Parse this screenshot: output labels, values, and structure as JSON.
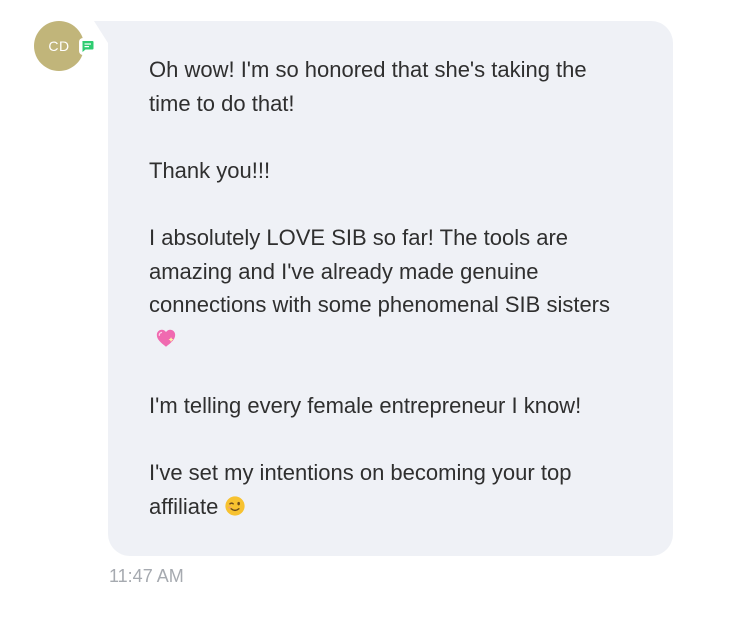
{
  "avatar": {
    "initials": "CD",
    "bg_color": "#c1b57a",
    "badge_icon": "chat-bubble-icon",
    "badge_color": "#2ecc71"
  },
  "message": {
    "bubble_color": "#eff1f6",
    "paragraphs": [
      "Oh wow! I'm so honored that she's taking the time to do that!",
      "Thank you!!!",
      "I absolutely LOVE SIB so far! The tools are amazing and I've already made genuine connections with some phenomenal SIB sisters",
      "I'm telling every female entrepreneur I know!",
      "I've set my intentions on becoming your top affiliate"
    ],
    "emoji_heart": "sparkling-heart-emoji",
    "emoji_wink": "winking-face-emoji",
    "timestamp": "11:47 AM"
  }
}
